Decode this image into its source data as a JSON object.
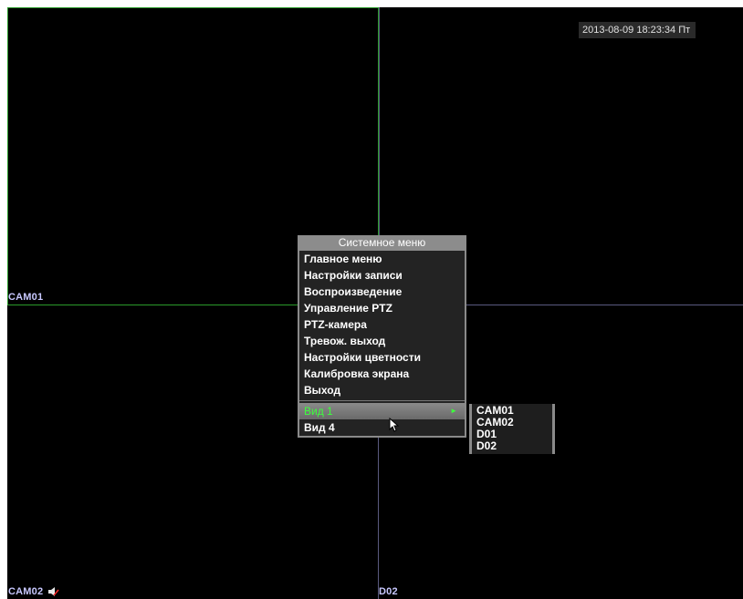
{
  "osd": {
    "datetime": "2013-08-09 18:23:34 Пт"
  },
  "panes": {
    "top_left": {
      "label": "CAM01"
    },
    "bottom_left": {
      "label": "CAM02",
      "icon": "speaker-icon"
    },
    "bottom_right": {
      "label": "D02"
    }
  },
  "system_menu": {
    "title": "Системное меню",
    "items": [
      {
        "label": "Главное меню"
      },
      {
        "label": "Настройки записи"
      },
      {
        "label": "Воспроизведение"
      },
      {
        "label": "Управление PTZ"
      },
      {
        "label": "PTZ-камера"
      },
      {
        "label": "Тревож. выход"
      },
      {
        "label": "Настройки цветности"
      },
      {
        "label": "Калибровка экрана"
      },
      {
        "label": "Выход"
      }
    ],
    "view_items": [
      {
        "label": "Вид 1",
        "selected": true
      },
      {
        "label": "Вид 4"
      }
    ]
  },
  "view_submenu": {
    "items": [
      {
        "label": "CAM01"
      },
      {
        "label": "CAM02"
      },
      {
        "label": "D01"
      },
      {
        "label": "D02"
      }
    ]
  },
  "colors": {
    "active_pane_border": "#2a9a2a",
    "selected_text": "#3cff3c",
    "menu_title_bg": "#8c8c8c",
    "camera_label": "#c8c8ff"
  }
}
